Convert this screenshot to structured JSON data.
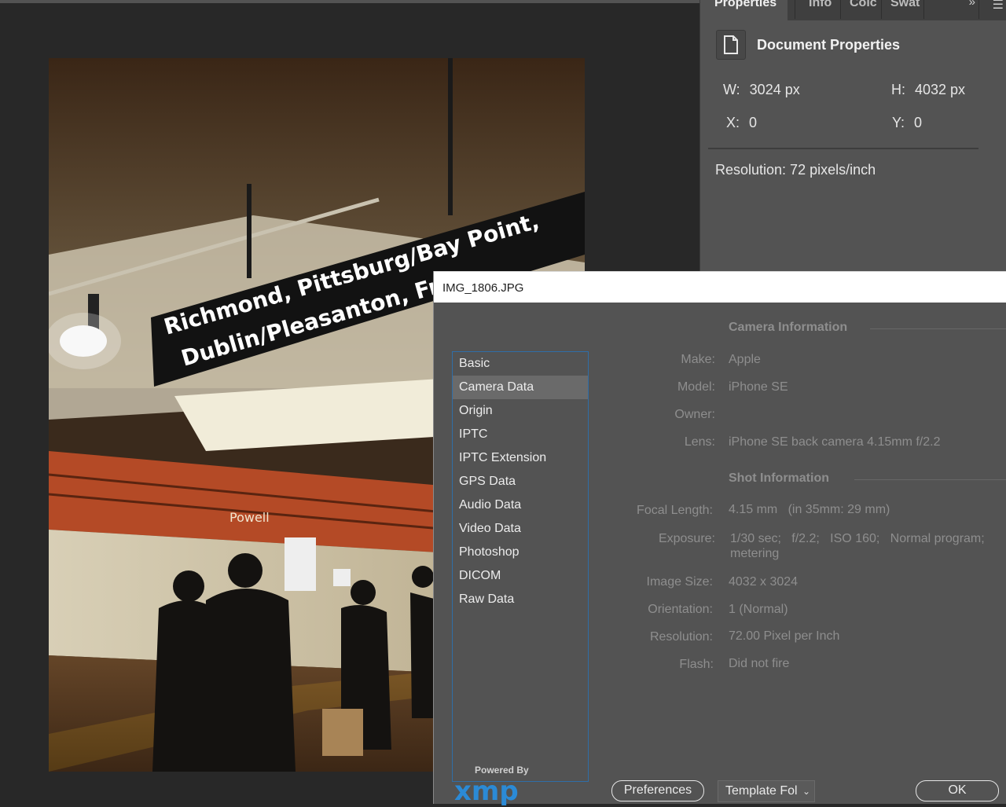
{
  "properties_panel": {
    "tabs": [
      "Properties",
      "Info",
      "Colc",
      "Swat"
    ],
    "overflow_icon": "double-chevron-right-icon",
    "menu_icon": "hamburger-icon",
    "header": {
      "icon": "document-icon",
      "title": "Document Properties"
    },
    "width": {
      "label": "W:",
      "value": "3024 px"
    },
    "height": {
      "label": "H:",
      "value": "4032 px"
    },
    "x": {
      "label": "X:",
      "value": "0"
    },
    "y": {
      "label": "Y:",
      "value": "0"
    },
    "resolution": "Resolution: 72 pixels/inch"
  },
  "photo": {
    "sign_line1": "Richmond, Pittsburg/Bay Point,",
    "sign_line2": "Dublin/Pleasanton, Frem",
    "station_name": "Powell"
  },
  "dialog": {
    "title": "IMG_1806.JPG",
    "categories": [
      {
        "label": "Basic",
        "selected": false
      },
      {
        "label": "Camera Data",
        "selected": true
      },
      {
        "label": "Origin",
        "selected": false
      },
      {
        "label": "IPTC",
        "selected": false
      },
      {
        "label": "IPTC Extension",
        "selected": false
      },
      {
        "label": "GPS Data",
        "selected": false
      },
      {
        "label": "Audio Data",
        "selected": false
      },
      {
        "label": "Video Data",
        "selected": false
      },
      {
        "label": "Photoshop",
        "selected": false
      },
      {
        "label": "DICOM",
        "selected": false
      },
      {
        "label": "Raw Data",
        "selected": false
      }
    ],
    "camera_info": {
      "title": "Camera Information",
      "make_label": "Make:",
      "make": "Apple",
      "model_label": "Model:",
      "model": "iPhone SE",
      "owner_label": "Owner:",
      "owner": "",
      "lens_label": "Lens:",
      "lens": "iPhone SE back camera 4.15mm f/2.2"
    },
    "shot_info": {
      "title": "Shot Information",
      "focal_label": "Focal Length:",
      "focal": "4.15 mm   (in 35mm: 29 mm)",
      "exposure_label": "Exposure:",
      "exposure": "1/30 sec;   f/2.2;   ISO 160;   Normal program;",
      "exposure_cont": "metering",
      "size_label": "Image Size:",
      "size": "4032 x 3024",
      "orientation_label": "Orientation:",
      "orientation": "1 (Normal)",
      "resolution_label": "Resolution:",
      "resolution": "72.00 Pixel per Inch",
      "flash_label": "Flash:",
      "flash": "Did not fire"
    },
    "powered_by": "Powered By",
    "logo_text": "xmp",
    "preferences_label": "Preferences",
    "template_label": "Template Fol",
    "ok_label": "OK"
  }
}
